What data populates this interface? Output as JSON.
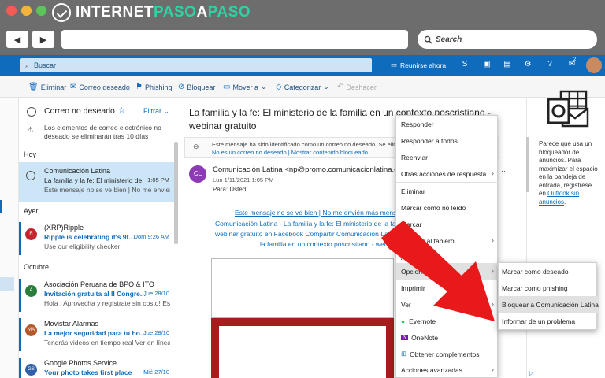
{
  "brand": {
    "pre": "INTERNET",
    "accent": "PASO",
    "mid": "A",
    "accent2": "PASO"
  },
  "browser": {
    "back": "◀",
    "forward": "▶",
    "search_label": "Search"
  },
  "header": {
    "search_placeholder": "Buscar",
    "meet": "Reunirse ahora",
    "badge": "2"
  },
  "toolbar": {
    "delete": "Eliminar",
    "junk": "Correo deseado",
    "phishing": "Phishing",
    "block": "Bloquear",
    "move": "Mover a",
    "categorize": "Categorizar",
    "undo": "Deshacer",
    "more": "···"
  },
  "list": {
    "folder": "Correo no deseado",
    "filter": "Filtrar",
    "notice": "Los elementos de correo electrónico no deseado se eliminarán tras 10 días",
    "sections": [
      "Hoy",
      "Ayer",
      "Octubre"
    ],
    "items": [
      {
        "from": "Comunicación Latina",
        "subject": "La familia y la fe: El ministerio de",
        "date": "1:05 PM",
        "preview": "Este mensaje no se ve bien | No me envien",
        "avatar": ""
      },
      {
        "from": "(XRP)Ripple",
        "subject": "Ripple is celebrating it's 9t...",
        "date": "Dom 9:26 AM",
        "preview": "Use our eligibility checker",
        "avatar": "R"
      },
      {
        "from": "Asociación Peruana de BPO & ITO",
        "subject": "Invitación gratuita al II Congre...",
        "date": "Jue 28/10",
        "preview": "Hola : Aprovecha y regístrate sin costo! Este",
        "avatar": "A"
      },
      {
        "from": "Movistar Alarmas",
        "subject": "La mejor seguridad para tu ho...",
        "date": "Jue 28/10",
        "preview": "Tendrás videos en tiempo real Ver en línea...",
        "avatar": "MA"
      },
      {
        "from": "Google Photos Service",
        "subject": "Your photo takes first place",
        "date": "Mié 27/10",
        "preview": "",
        "avatar": "GS"
      }
    ]
  },
  "reading": {
    "title": "La familia y la fe: El ministerio de la familia en un contexto poscristiano - webinar gratuito",
    "junk_notice": "Este mensaje ha sido identificado como un correo no deseado. Se eliminará",
    "not_junk": "No es un correo no deseado",
    "show_blocked": "Mostrar contenido bloqueado",
    "sender": "Comunicación Latina <np@promo.comunicacionlatina.com",
    "sender_initials": "CL",
    "sent": "Lun 1/11/2021 1:05 PM",
    "to": "Para:  Usted",
    "body": [
      "Este mensaje no se ve bien | No me envién más mensa",
      "Comunicación Latina - La familia y la fe: El ministerio de la familia",
      "webinar gratuito en Facebook Compartir Comunicación Latina",
      "la familia en un contexto poscristiano - webin"
    ]
  },
  "context_menu": {
    "items": [
      "Responder",
      "Responder a todos",
      "Reenviar",
      "Otras acciones de respuesta",
      "Eliminar",
      "Marcar como no leído",
      "Marcar",
      "Agregar al tablero",
      "A",
      "Opciones",
      "Imprimir",
      "Ver",
      "Evernote",
      "OneNote",
      "Obtener complementos",
      "Acciones avanzadas"
    ],
    "submenu": [
      "Marcar como deseado",
      "Marcar como phishing",
      "Bloquear a Comunicación Latina",
      "Informar de un problema"
    ]
  },
  "ad": {
    "text": "Parece que usa un bloqueador de anuncios. Para maximizar el espacio en la bandeja de entrada, regístrese en",
    "link": "Outlook sin anuncios",
    "end": "."
  },
  "colors": {
    "accent": "#0f6cbd",
    "arrow": "#e8191a",
    "brand": "#2ed2a3"
  }
}
